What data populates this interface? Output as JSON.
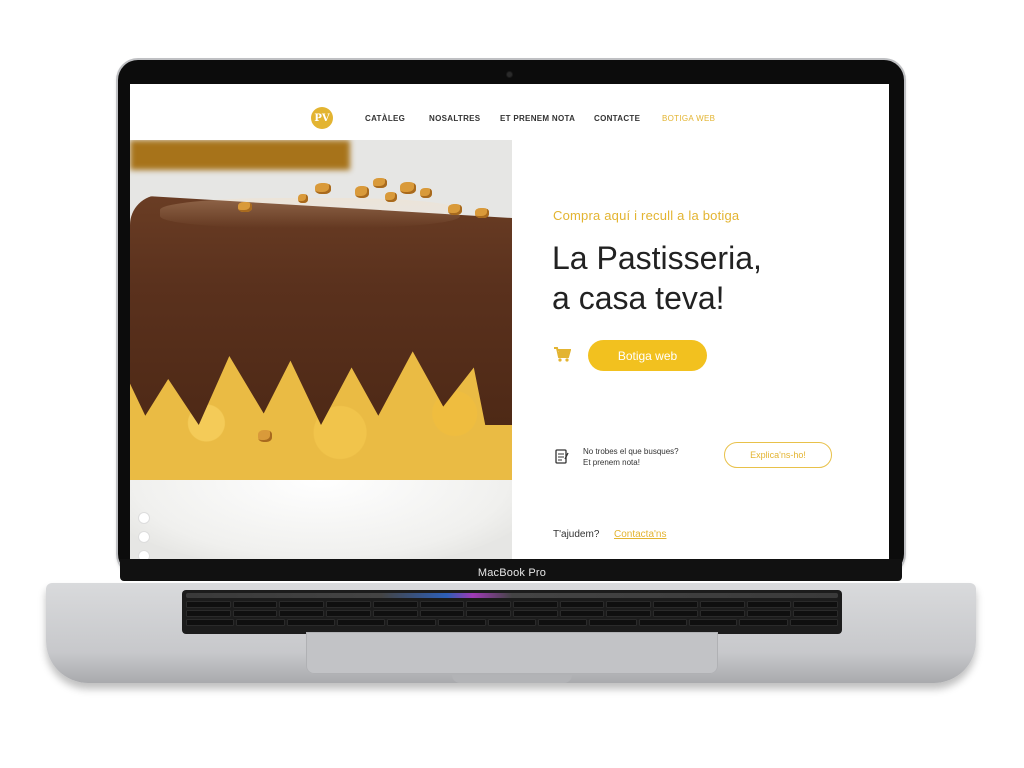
{
  "device": {
    "label": "MacBook Pro"
  },
  "site": {
    "logo_text": "PV",
    "nav": {
      "items": [
        {
          "label": "CATÀLEG"
        },
        {
          "label": "NOSALTRES"
        },
        {
          "label": "ET PRENEM NOTA"
        },
        {
          "label": "CONTACTE"
        },
        {
          "label": "BOTIGA WEB",
          "active": true
        }
      ]
    },
    "hero": {
      "image_icon": "chocolate-cake-image",
      "slide_count": 5,
      "active_slide": 1
    },
    "main": {
      "subtitle": "Compra aquí i recull a la botiga",
      "headline_line1": "La Pastisseria,",
      "headline_line2": "a casa teva!",
      "shop_button": "Botiga web",
      "cart_icon": "cart-icon"
    },
    "note": {
      "line1": "No trobes el que busques?",
      "line2": "Et prenem nota!",
      "button": "Explica'ns-ho!",
      "icon": "notepad-icon"
    },
    "help": {
      "text": "T'ajudem?",
      "link": "Contacta'ns"
    }
  },
  "colors": {
    "accent": "#e3b431",
    "button": "#f2c11f",
    "text": "#222222"
  }
}
